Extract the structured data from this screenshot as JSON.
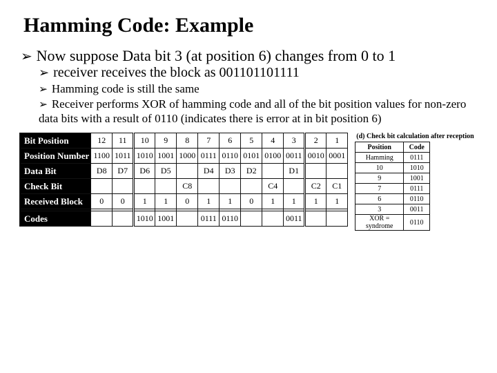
{
  "title": "Hamming Code: Example",
  "bullet1": "Now suppose Data bit 3 (at position 6) changes from 0 to 1",
  "bullet2": "receiver receives  the block as 001101101111",
  "bullet3": "Hamming code is still the same",
  "bullet4": "Receiver performs XOR of hamming code and all of the bit position values for non-zero data bits with a result of 0110 (indicates there is error at in bit position 6)",
  "main_table": {
    "row_labels": [
      "Bit Position",
      "Position Number",
      "Data Bit",
      "Check Bit",
      "Received Block",
      "Codes"
    ],
    "cols": [
      "12",
      "11",
      "10",
      "9",
      "8",
      "7",
      "6",
      "5",
      "4",
      "3",
      "2",
      "1"
    ],
    "position_number": [
      "1100",
      "1011",
      "1010",
      "1001",
      "1000",
      "0111",
      "0110",
      "0101",
      "0100",
      "0011",
      "0010",
      "0001"
    ],
    "data_bit": [
      "D8",
      "D7",
      "D6",
      "D5",
      "",
      "D4",
      "D3",
      "D2",
      "",
      "D1",
      "",
      ""
    ],
    "check_bit": [
      "",
      "",
      "",
      "",
      "C8",
      "",
      "",
      "",
      "C4",
      "",
      "C2",
      "C1"
    ],
    "received": [
      "0",
      "0",
      "1",
      "1",
      "0",
      "1",
      "1",
      "0",
      "1",
      "1",
      "1",
      "1"
    ],
    "codes": [
      "",
      "",
      "1010",
      "1001",
      "",
      "0111",
      "0110",
      "",
      "",
      "0011",
      "",
      ""
    ]
  },
  "side": {
    "caption": "(d) Check bit calculation after reception",
    "headers": [
      "Position",
      "Code"
    ],
    "rows": [
      [
        "Hamming",
        "0111"
      ],
      [
        "10",
        "1010"
      ],
      [
        "9",
        "1001"
      ],
      [
        "7",
        "0111"
      ],
      [
        "6",
        "0110"
      ],
      [
        "3",
        "0011"
      ],
      [
        "XOR = syndrome",
        "0110"
      ]
    ]
  }
}
